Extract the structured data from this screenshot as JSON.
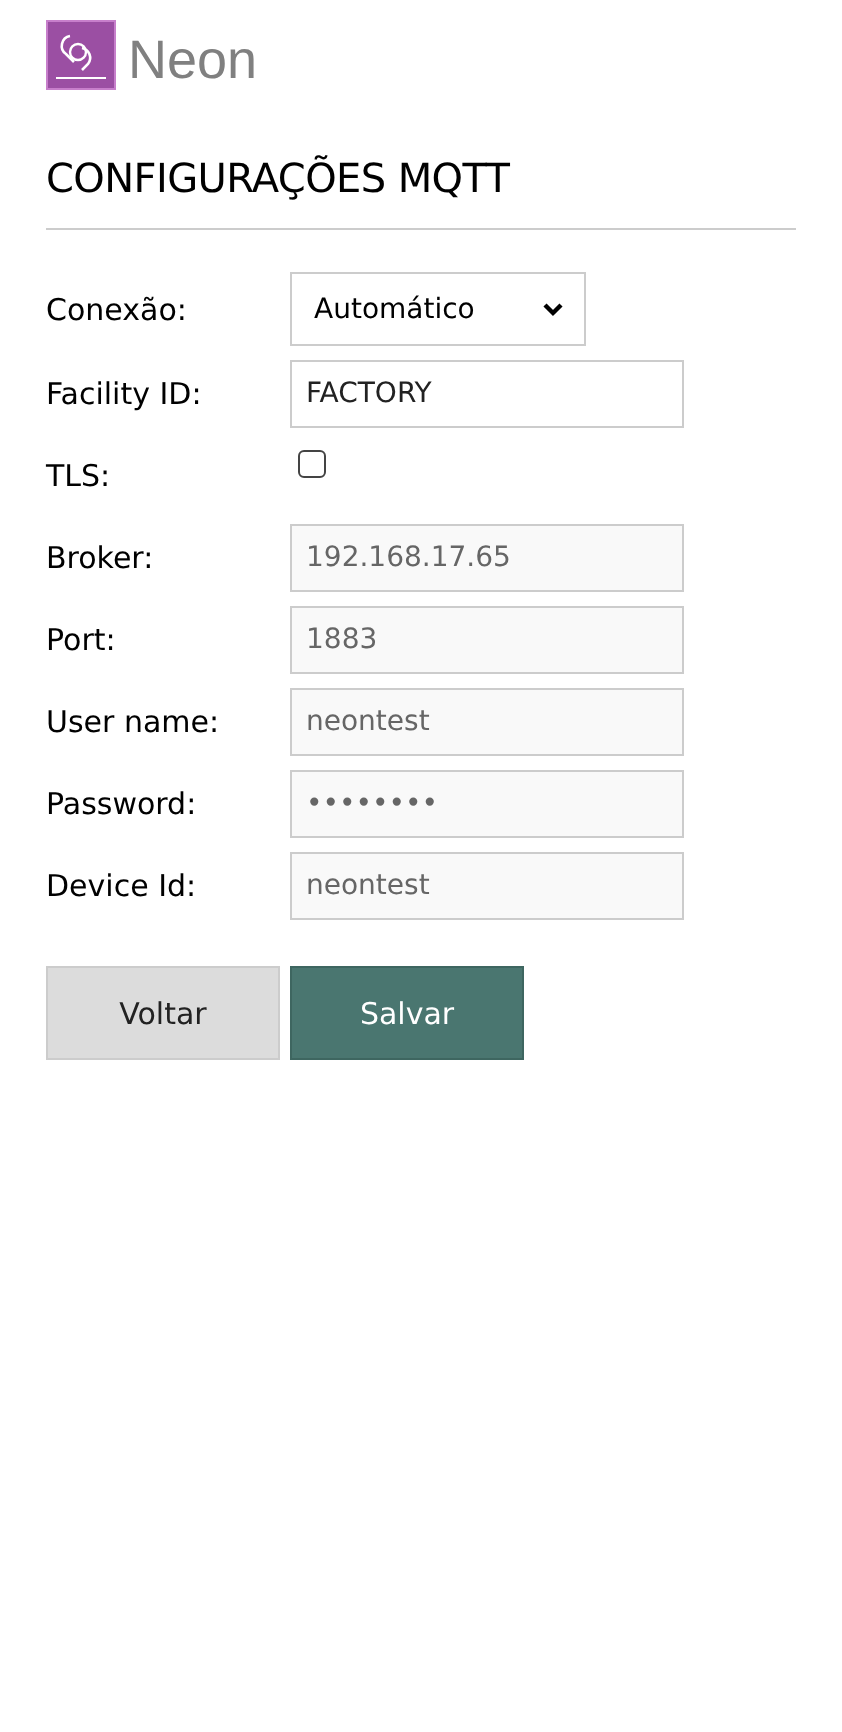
{
  "brand": {
    "name": "Neon"
  },
  "page_title": "CONFIGURAÇÕES MQTT",
  "fields": [
    {
      "kind": "select",
      "label": "Conexão:",
      "value": "Automático"
    },
    {
      "kind": "text",
      "label": "Facility ID:",
      "value": "FACTORY",
      "disabled": false
    },
    {
      "kind": "checkbox",
      "label": "TLS:",
      "checked": false
    },
    {
      "kind": "text",
      "label": "Broker:",
      "value": "192.168.17.65",
      "disabled": true
    },
    {
      "kind": "text",
      "label": "Port:",
      "value": "1883",
      "disabled": true
    },
    {
      "kind": "text",
      "label": "User name:",
      "value": "neontest",
      "disabled": true
    },
    {
      "kind": "text",
      "label": "Password:",
      "value": "••••••••",
      "disabled": true
    },
    {
      "kind": "text",
      "label": "Device Id:",
      "value": "neontest",
      "disabled": true
    }
  ],
  "buttons": [
    {
      "label": "Voltar",
      "kind": "secondary"
    },
    {
      "label": "Salvar",
      "kind": "primary"
    }
  ]
}
